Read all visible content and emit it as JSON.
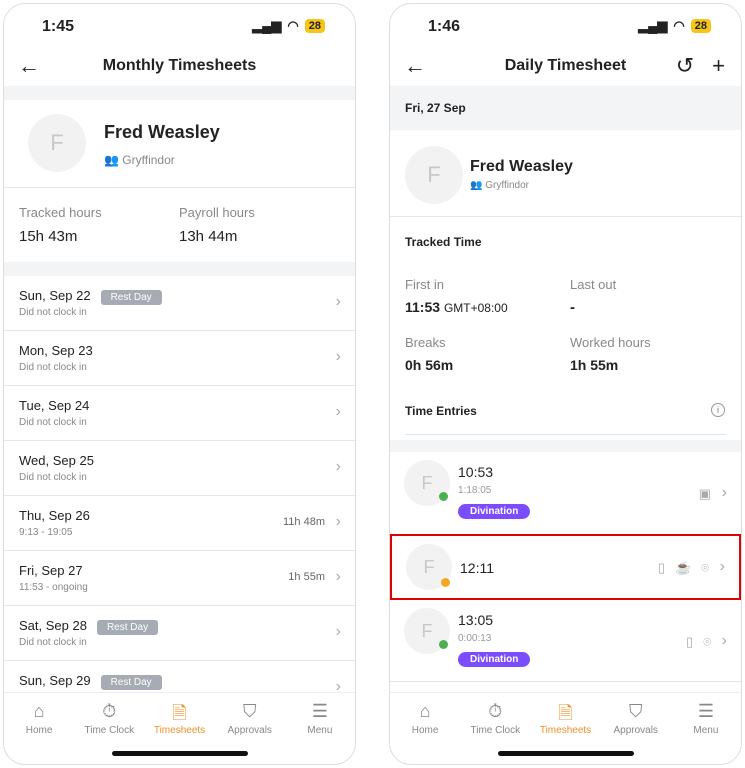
{
  "left": {
    "status": {
      "time": "1:45",
      "battery": "28"
    },
    "title": "Monthly Timesheets",
    "profile": {
      "initial": "F",
      "name": "Fred Weasley",
      "team": "Gryffindor"
    },
    "stats": [
      {
        "label": "Tracked hours",
        "value": "15h 43m"
      },
      {
        "label": "Payroll hours",
        "value": "13h 44m"
      }
    ],
    "days": [
      {
        "date": "Sun, Sep 22",
        "badge": "Rest Day",
        "sub": "Did not clock in",
        "hours": ""
      },
      {
        "date": "Mon, Sep 23",
        "badge": "",
        "sub": "Did not clock in",
        "hours": ""
      },
      {
        "date": "Tue, Sep 24",
        "badge": "",
        "sub": "Did not clock in",
        "hours": ""
      },
      {
        "date": "Wed, Sep 25",
        "badge": "",
        "sub": "Did not clock in",
        "hours": ""
      },
      {
        "date": "Thu, Sep 26",
        "badge": "",
        "sub": "9:13 - 19:05",
        "hours": "11h 48m"
      },
      {
        "date": "Fri, Sep 27",
        "badge": "",
        "sub": "11:53 - ongoing",
        "hours": "1h 55m"
      },
      {
        "date": "Sat, Sep 28",
        "badge": "Rest Day",
        "sub": "Did not clock in",
        "hours": ""
      },
      {
        "date": "Sun, Sep 29",
        "badge": "Rest Day",
        "sub": "",
        "hours": ""
      }
    ]
  },
  "right": {
    "status": {
      "time": "1:46",
      "battery": "28"
    },
    "title": "Daily Timesheet",
    "date": "Fri, 27 Sep",
    "profile": {
      "initial": "F",
      "name": "Fred Weasley",
      "team": "Gryffindor"
    },
    "tracked_title": "Tracked Time",
    "first_in": {
      "label": "First in",
      "value": "11:53",
      "tz": "GMT+08:00"
    },
    "last_out": {
      "label": "Last out",
      "value": "-"
    },
    "breaks": {
      "label": "Breaks",
      "value": "0h 56m"
    },
    "worked": {
      "label": "Worked hours",
      "value": "1h 55m"
    },
    "entries_title": "Time Entries",
    "entries": [
      {
        "time": "10:53",
        "duration": "1:18:05",
        "tag": "Divination",
        "status": "green"
      },
      {
        "time": "12:11",
        "duration": "",
        "tag": "",
        "status": "orange"
      },
      {
        "time": "13:05",
        "duration": "0:00:13",
        "tag": "Divination",
        "status": "green"
      }
    ]
  },
  "tabs": [
    {
      "label": "Home",
      "icon": "home-icon"
    },
    {
      "label": "Time Clock",
      "icon": "stopwatch-icon"
    },
    {
      "label": "Timesheets",
      "icon": "timesheet-icon",
      "active": true
    },
    {
      "label": "Approvals",
      "icon": "shield-check-icon"
    },
    {
      "label": "Menu",
      "icon": "menu-icon"
    }
  ],
  "colors": {
    "accent": "#f0902b",
    "tag": "#7c4dff",
    "green": "#4caf50",
    "orange": "#f5a623",
    "highlight": "#e00000",
    "break": "#e0405a"
  }
}
